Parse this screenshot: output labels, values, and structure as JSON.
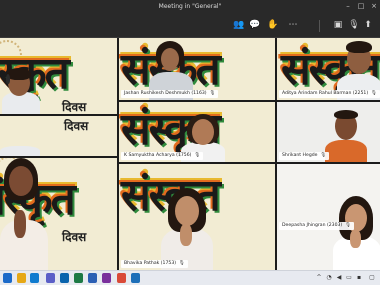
{
  "window": {
    "title": "Meeting in \"General\""
  },
  "toolbar": {
    "buttons": [
      {
        "name": "participants-icon",
        "glyph": "👥"
      },
      {
        "name": "chat-icon",
        "glyph": "💬"
      },
      {
        "name": "raise-hand-icon",
        "glyph": "✋"
      },
      {
        "name": "more-options-icon",
        "glyph": "⋯"
      },
      {
        "name": "camera-icon",
        "glyph": "▣"
      },
      {
        "name": "microphone-icon",
        "glyph": "🎙"
      },
      {
        "name": "share-screen-icon",
        "glyph": "⬆"
      },
      {
        "name": "leave-call-icon",
        "glyph": "☎"
      }
    ]
  },
  "poster": {
    "word": "संस्कृत",
    "sub1": "दिवस",
    "sub2": "दिवस"
  },
  "participants": [
    {
      "id": "t1",
      "name": ""
    },
    {
      "id": "t2",
      "name": "Jashan Rushikesh Deshmukh (1163)"
    },
    {
      "id": "t3",
      "name": "Aditya Arindam Rahul Barman (2251)"
    },
    {
      "id": "t4",
      "name": ""
    },
    {
      "id": "t5",
      "name": "K Samyuktha Acharya (1756)"
    },
    {
      "id": "t6",
      "name": "Shrikant Hegde"
    },
    {
      "id": "t7",
      "name": ""
    },
    {
      "id": "t8",
      "name": "Bhavika Pathak (1753)"
    },
    {
      "id": "t9",
      "name": "Deepasha Jhingran (2303)"
    }
  ],
  "taskbar": {
    "apps": [
      {
        "name": "windows-start-icon",
        "color": "#1b6ac9"
      },
      {
        "name": "explorer-icon",
        "color": "#e6a817"
      },
      {
        "name": "edge-icon",
        "color": "#0f7bcf"
      },
      {
        "name": "teams-icon",
        "color": "#5b5fc7"
      },
      {
        "name": "outlook-icon",
        "color": "#0a64ad"
      },
      {
        "name": "excel-icon",
        "color": "#1d7a45"
      },
      {
        "name": "word-icon",
        "color": "#2b5fb4"
      },
      {
        "name": "onenote-icon",
        "color": "#7a2f9c"
      },
      {
        "name": "chrome-icon",
        "color": "#d94a38"
      },
      {
        "name": "mail-icon",
        "color": "#1d6fb8"
      }
    ]
  }
}
